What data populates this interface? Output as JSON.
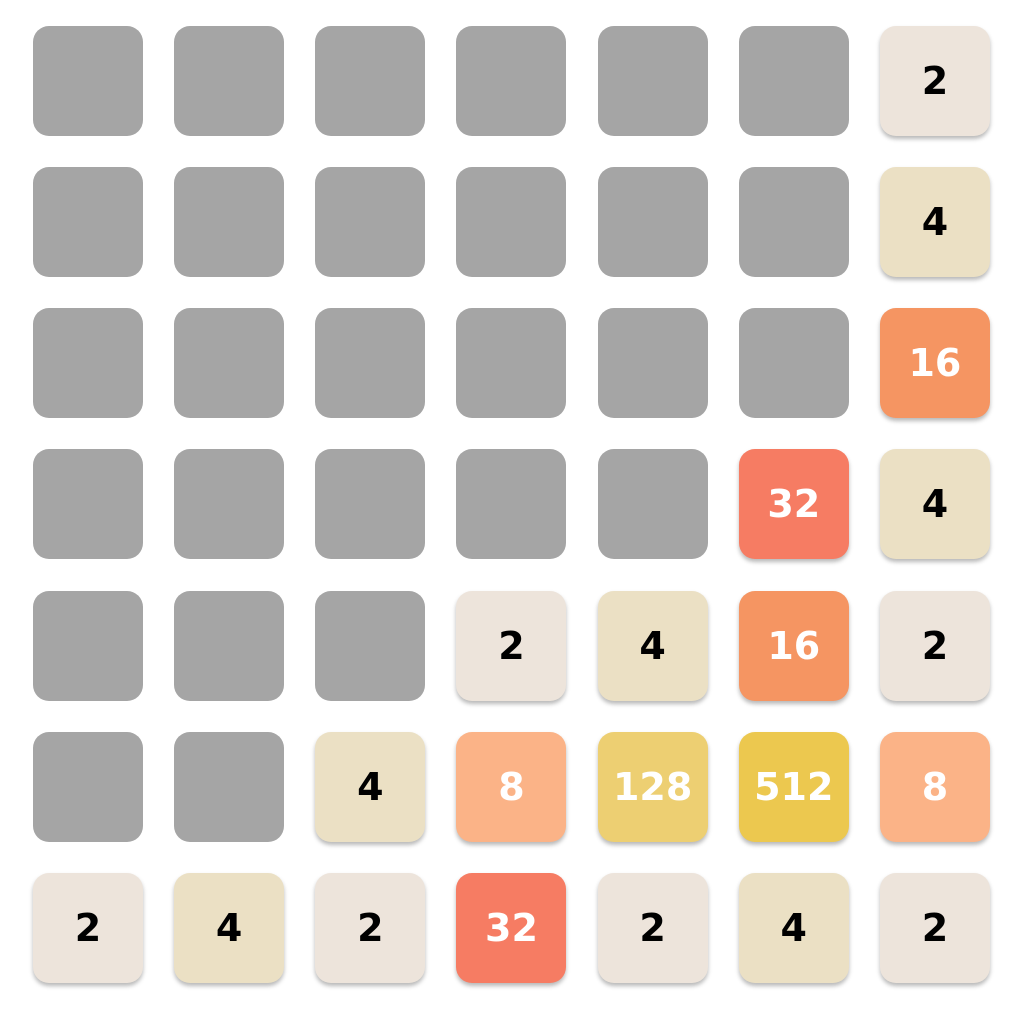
{
  "board": {
    "size": 7,
    "cells": [
      [
        0,
        0,
        0,
        0,
        0,
        0,
        2
      ],
      [
        0,
        0,
        0,
        0,
        0,
        0,
        4
      ],
      [
        0,
        0,
        0,
        0,
        0,
        0,
        16
      ],
      [
        0,
        0,
        0,
        0,
        0,
        32,
        4
      ],
      [
        0,
        0,
        0,
        2,
        4,
        16,
        2
      ],
      [
        0,
        0,
        4,
        8,
        128,
        512,
        8
      ],
      [
        2,
        4,
        2,
        32,
        2,
        4,
        2
      ]
    ]
  },
  "tile_colors": {
    "0": {
      "bg": "#a5a5a5",
      "fg": "#000000"
    },
    "2": {
      "bg": "#ede4db",
      "fg": "#000000"
    },
    "4": {
      "bg": "#ebe0c4",
      "fg": "#000000"
    },
    "8": {
      "bg": "#fbb387",
      "fg": "#ffffff"
    },
    "16": {
      "bg": "#f59562",
      "fg": "#ffffff"
    },
    "32": {
      "bg": "#f67c63",
      "fg": "#ffffff"
    },
    "128": {
      "bg": "#edcf72",
      "fg": "#ffffff"
    },
    "512": {
      "bg": "#ecc84f",
      "fg": "#ffffff"
    }
  }
}
